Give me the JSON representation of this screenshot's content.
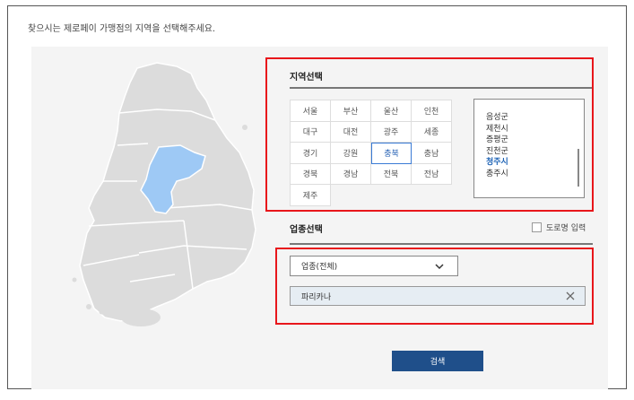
{
  "intro_text": "찾으시는 제로페이 가맹점의 지역을 선택해주세요.",
  "region_section": {
    "title": "지역선택",
    "regions": [
      "서울",
      "부산",
      "울산",
      "인천",
      "대구",
      "대전",
      "광주",
      "세종",
      "경기",
      "강원",
      "충북",
      "충남",
      "경북",
      "경남",
      "전북",
      "전남",
      "제주"
    ],
    "selected_region": "충북"
  },
  "city_list": {
    "items": [
      "음성군",
      "제천시",
      "증평군",
      "진천군",
      "청주시",
      "충주시"
    ],
    "selected": "청주시"
  },
  "business_section": {
    "title": "업종선택",
    "road_name_label": "도로명 입력",
    "category_select": "업종(전체)",
    "keyword_value": "파리카나"
  },
  "search_button": "검색",
  "colors": {
    "highlight_border": "#e8161b",
    "selected_text": "#2a64b5",
    "map_highlight": "#9ec9f5",
    "button_bg": "#1f4f8a"
  }
}
